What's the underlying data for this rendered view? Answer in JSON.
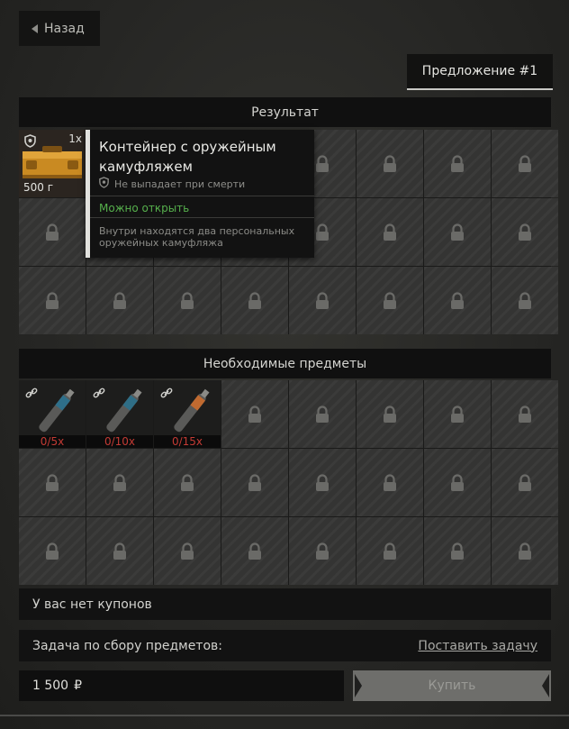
{
  "nav": {
    "back_label": "Назад"
  },
  "offer": {
    "tab_label": "Предложение #1"
  },
  "result": {
    "header": "Результат",
    "item": {
      "name": "Контейнер с оружейным камуфляжем",
      "count": "1x",
      "weight": "500 г",
      "no_drop_label": "Не выпадает при смерти",
      "open_label": "Можно открыть",
      "description": "Внутри находятся два персональных оружейных камуфляжа"
    }
  },
  "required": {
    "header": "Необходимые предметы",
    "items": [
      {
        "icon": "link-icon",
        "count": "0/5x",
        "color": "#2e6f8a"
      },
      {
        "icon": "link-icon",
        "count": "0/10x",
        "color": "#2f6e86"
      },
      {
        "icon": "link-icon",
        "count": "0/15x",
        "color": "#c06a30"
      }
    ]
  },
  "coupons": {
    "label": "У вас нет купонов"
  },
  "task": {
    "label": "Задача по сбору предметов:",
    "action_label": "Поставить задачу"
  },
  "price": {
    "amount": "1 500",
    "currency": "₽"
  },
  "buy": {
    "label": "Купить"
  },
  "colors": {
    "accent_green": "#56b04c",
    "missing_red": "#c33a34"
  }
}
